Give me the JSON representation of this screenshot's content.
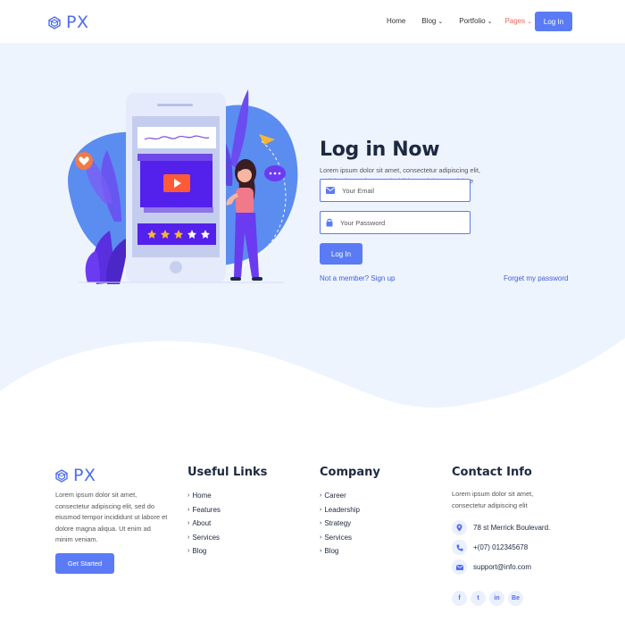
{
  "brand": {
    "name": "PX",
    "color": "#4e6cf0",
    "icon": "hexagon-logo-icon"
  },
  "nav": {
    "items": [
      {
        "label": "Home",
        "has_dropdown": false,
        "active": false
      },
      {
        "label": "Blog",
        "has_dropdown": true,
        "active": false
      },
      {
        "label": "Portfolio",
        "has_dropdown": true,
        "active": false
      },
      {
        "label": "Pages",
        "has_dropdown": true,
        "active": true
      }
    ],
    "login_label": "Log In"
  },
  "hero": {
    "title": "Log in Now",
    "description": "Lorem ipsum dolor sit amet, consectetur adipiscing elit, sed do eiusmod tempor incididunt ut labore et dolore magna aliqua. Ut enim ad minim veniam.",
    "email_placeholder": "Your Email",
    "password_placeholder": "Your Password",
    "submit_label": "Log In",
    "signup_link": "Not a member? Sign up",
    "forgot_link": "Forget my password",
    "background": "#eef4fe",
    "accent": "#5a7bf4"
  },
  "footer": {
    "about": {
      "description": "Lorem ipsum dolor sit amet, consectetur adipiscing elit, sed do eiusmod tempor incididunt ut labore et dolore magna aliqua. Ut enim ad minim veniam.",
      "cta": "Get Started"
    },
    "useful_links": {
      "title": "Useful Links",
      "items": [
        "Home",
        "Features",
        "About",
        "Services",
        "Blog"
      ]
    },
    "company": {
      "title": "Company",
      "items": [
        "Career",
        "Leadership",
        "Strategy",
        "Services",
        "Blog"
      ]
    },
    "contact": {
      "title": "Contact Info",
      "description": "Lorem ipsum dolor sit amet, consectetur adipiscing elit",
      "address": "78 st Merrick Boulevard.",
      "phone": "+(07) 012345678",
      "email": "support@info.com"
    },
    "socials": [
      "f",
      "t",
      "in",
      "Be"
    ]
  }
}
